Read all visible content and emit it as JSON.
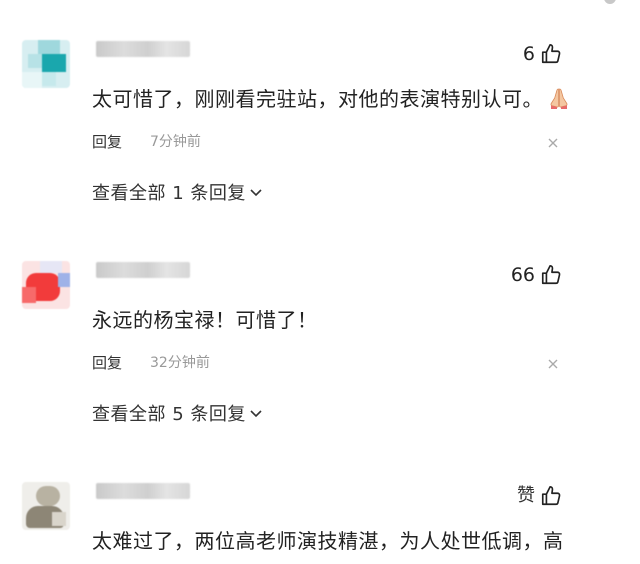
{
  "comments": [
    {
      "username": "",
      "likes": "6",
      "text": "太可惜了，刚刚看完驻站，对他的表演特别认可。",
      "trailing_emoji": "pray-icon",
      "reply_label": "回复",
      "time": "7分钟前",
      "view_replies": "查看全部 1 条回复"
    },
    {
      "username": "",
      "likes": "66",
      "text": "永远的杨宝禄！可惜了！",
      "reply_label": "回复",
      "time": "32分钟前",
      "view_replies": "查看全部 5 条回复"
    },
    {
      "username": "",
      "likes": "赞",
      "text": "太难过了，两位高老师演技精湛，为人处世低调，高老艺高，保重身体"
    }
  ],
  "colors": {
    "text": "#222222",
    "meta": "#999999",
    "background": "#ffffff"
  }
}
